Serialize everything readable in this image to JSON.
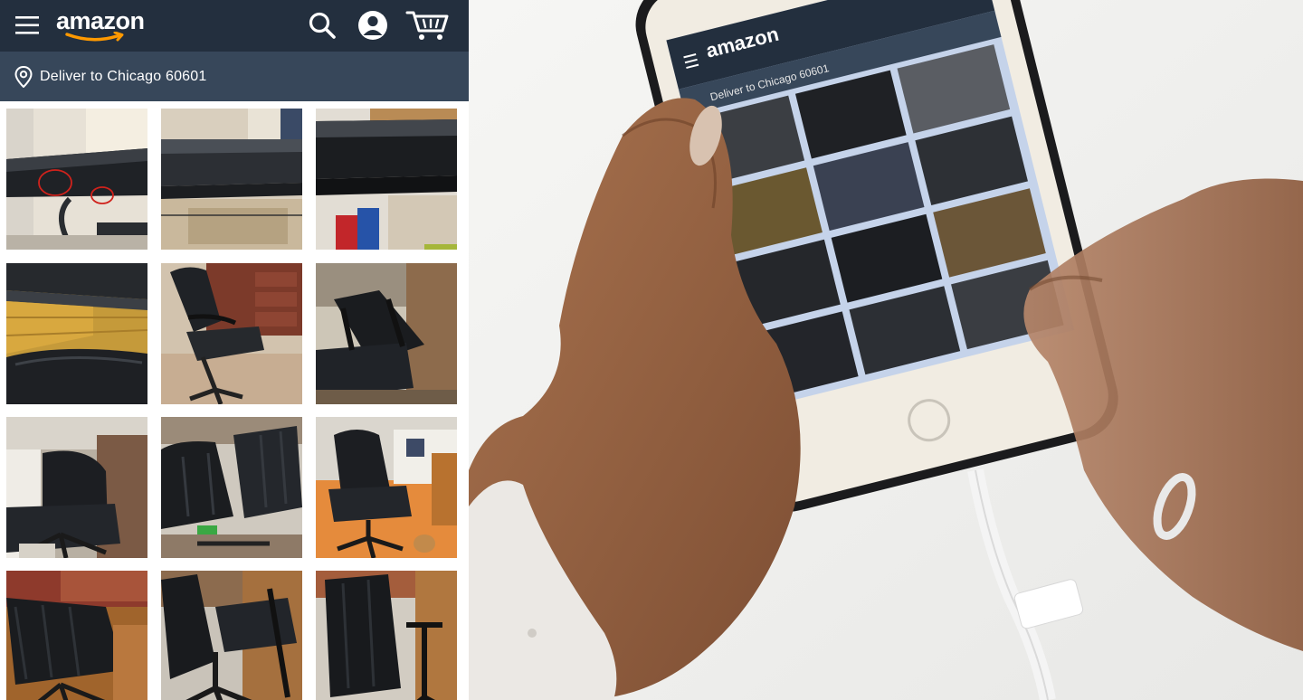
{
  "header": {
    "logo_text": "amazon",
    "menu_icon": "hamburger-menu-icon",
    "search_icon": "search-icon",
    "account_icon": "account-icon",
    "cart_icon": "cart-icon",
    "colors": {
      "nav_bg": "#232f3e",
      "subnav_bg": "#37475a",
      "accent": "#ff9900"
    }
  },
  "delivery": {
    "icon": "location-pin-icon",
    "label": "Deliver to Chicago 60601"
  },
  "customer_images": {
    "rows": 4,
    "columns": 3,
    "tiles": [
      "desk-edge-marked-damage-photo",
      "desk-edge-photo",
      "desk-edge-closeup-photo",
      "desk-and-chair-photo",
      "black-office-chair-photo",
      "office-chair-desk-photo",
      "office-chair-side-photo",
      "office-chair-top-photo",
      "office-chair-room-photo",
      "office-chair-rug-photo",
      "office-chair-base-photo",
      "office-chair-back-photo"
    ]
  },
  "phone_screen": {
    "logo_text": "amazon",
    "delivery_label": "Deliver to Chicago 60601"
  }
}
